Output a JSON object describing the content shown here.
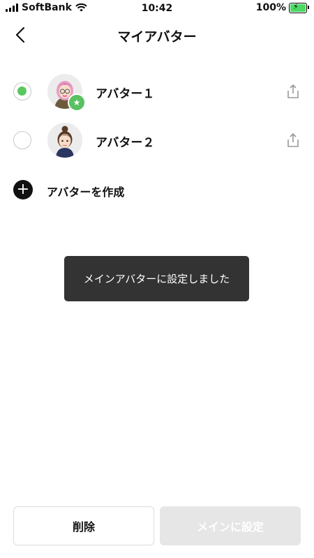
{
  "status_bar": {
    "carrier": "SoftBank",
    "time": "10:42",
    "battery": "100%",
    "signal_icon": "signal-icon",
    "wifi_icon": "wifi-icon"
  },
  "header": {
    "title": "マイアバター",
    "back_icon": "chevron-left-icon"
  },
  "avatars": [
    {
      "label": "アバター１",
      "selected": true,
      "main_badge": "star-icon"
    },
    {
      "label": "アバター２",
      "selected": false
    }
  ],
  "create": {
    "label": "アバターを作成",
    "icon": "plus-icon"
  },
  "toast": {
    "message": "メインアバターに設定しました"
  },
  "buttons": {
    "delete_label": "削除",
    "set_main_label": "メインに設定",
    "set_main_enabled": false
  },
  "colors": {
    "selected_green": "#5ac75f",
    "toast_bg": "#333333",
    "disabled_button_bg": "#e6e6e6"
  }
}
